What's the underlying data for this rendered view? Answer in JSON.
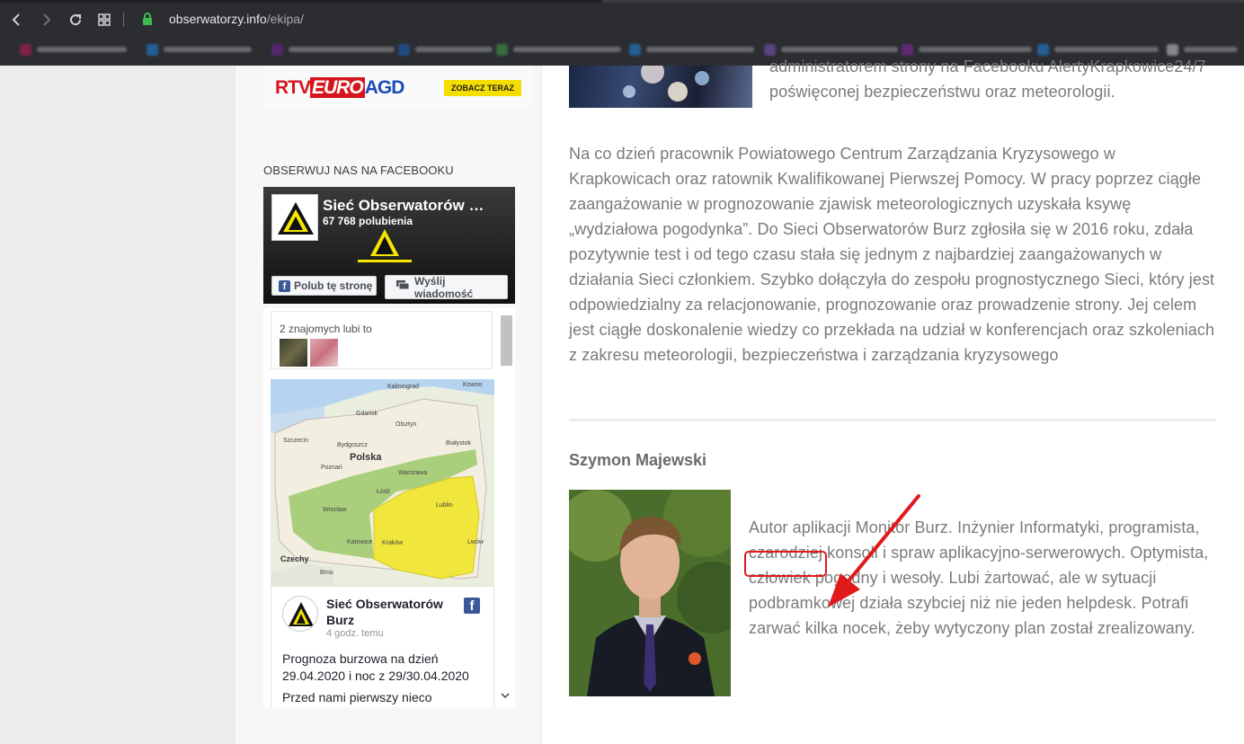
{
  "browser": {
    "url_host": "obserwatorzy.info",
    "url_path": "/ekipa/"
  },
  "ad": {
    "logo_rtv": "RTV",
    "logo_euro": "EURO",
    "logo_agd": "AGD",
    "cta": "ZOBACZ TERAZ"
  },
  "sidebar": {
    "facebook_heading": "OBSERWUJ NAS NA FACEBOOKU",
    "fb_page": {
      "name": "Sieć Obserwatorów …",
      "likes": "67 768 polubienia",
      "like_button": "Polub tę stronę",
      "message_button": "Wyślij wiadomość",
      "friends_label": "2 znajomych lubi to"
    },
    "fb_post": {
      "author": "Sieć Obserwatorów Burz",
      "time": "4 godz. temu",
      "text": "Prognoza burzowa na dzień 29.04.2020 i noc z 29/30.04.2020",
      "text2": "Przed nami pierwszy nieco"
    },
    "map_labels": {
      "kaliningrad": "Kaliningrad",
      "kowno": "Kowno",
      "gdansk": "Gdańsk",
      "olsztyn": "Olsztyn",
      "szczecin": "Szczecin",
      "bydgoszcz": "Bydgoszcz",
      "bialystok": "Białystok",
      "polska": "Polska",
      "poznan": "Poznań",
      "warszawa": "Warszawa",
      "lodz": "Łódź",
      "wroclaw": "Wrocław",
      "lublin": "Lublin",
      "katowice": "Katowice",
      "krakow": "Kraków",
      "lwow": "Lwów",
      "czechy": "Czechy",
      "brno": "Brno"
    }
  },
  "article": {
    "top_paragraph": "administratorem strony na Facebooku AlertyKrapkowice24/7 poświęconej bezpieczeństwu oraz meteorologii.",
    "main_paragraph": "Na co dzień pracownik Powiatowego Centrum Zarządzania Kryzysowego w Krapkowicach oraz ratownik Kwalifikowanej Pierwszej Pomocy. W pracy poprzez ciągłe zaangażowanie w prognozowanie zjawisk meteorologicznych uzyskała ksywę „wydziałowa pogodynka”. Do Sieci Obserwatorów Burz zgłosiła się w 2016 roku, zdała pozytywnie test i od tego czasu stała się jednym z najbardziej zaangażowanych w działania Sieci członkiem. Szybko dołączyła do zespołu prognostycznego Sieci, który jest odpowiedzialny za relacjonowanie, prognozowanie oraz prowadzenie strony. Jej celem jest ciągłe doskonalenie wiedzy co przekłada na udział w konferencjach oraz szkoleniach z zakresu meteorologii, bezpieczeństwa i zarządzania kryzysowego",
    "person_name": "Szymon Majewski",
    "bio": "Autor aplikacji Monitor Burz. Inżynier Informatyki, programista, czarodziej konsoli i spraw aplikacyjno-serwerowych. Optymista, człowiek pogodny i wesoły. Lubi żartować, ale w sytuacji podbramkowej działa szybciej niż nie jeden helpdesk. Potrafi zarwać kilka nocek, żeby wytyczony plan został zrealizowany."
  },
  "colors": {
    "annotation": "#e0191b",
    "text_gray": "#7a7a7a",
    "facebook_blue": "#3b5998"
  }
}
